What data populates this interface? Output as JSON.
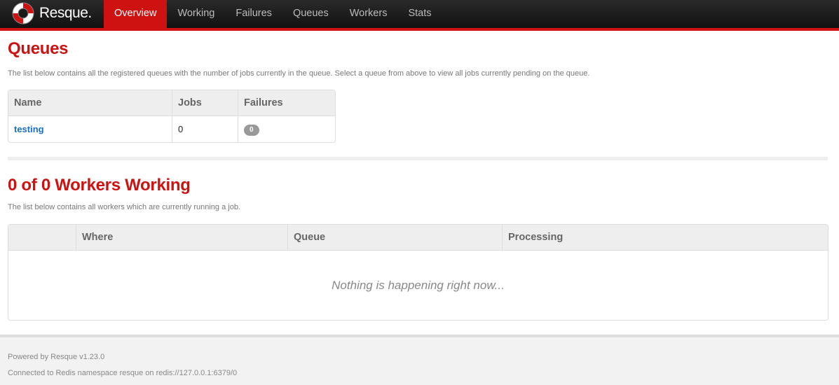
{
  "nav": {
    "brand": "Resque.",
    "tabs": [
      {
        "label": "Overview",
        "active": true
      },
      {
        "label": "Working"
      },
      {
        "label": "Failures"
      },
      {
        "label": "Queues"
      },
      {
        "label": "Workers"
      },
      {
        "label": "Stats"
      }
    ]
  },
  "queues": {
    "title": "Queues",
    "description": "The list below contains all the registered queues with the number of jobs currently in the queue. Select a queue from above to view all jobs currently pending on the queue.",
    "columns": [
      "Name",
      "Jobs",
      "Failures"
    ],
    "rows": [
      {
        "name": "testing",
        "jobs": "0",
        "failures": "0"
      }
    ]
  },
  "workers": {
    "title": "0 of 0 Workers Working",
    "description": "The list below contains all workers which are currently running a job.",
    "columns": [
      "",
      "Where",
      "Queue",
      "Processing"
    ],
    "empty_message": "Nothing is happening right now..."
  },
  "footer": {
    "powered_by": "Powered by Resque v1.23.0",
    "connection": "Connected to Redis namespace resque on redis://127.0.0.1:6379/0"
  },
  "colors": {
    "accent": "#ce1212",
    "link": "#1a6fc4",
    "navbar": "#1a1a1a"
  },
  "icons": {
    "brand_logo": "lifebuoy-icon"
  }
}
